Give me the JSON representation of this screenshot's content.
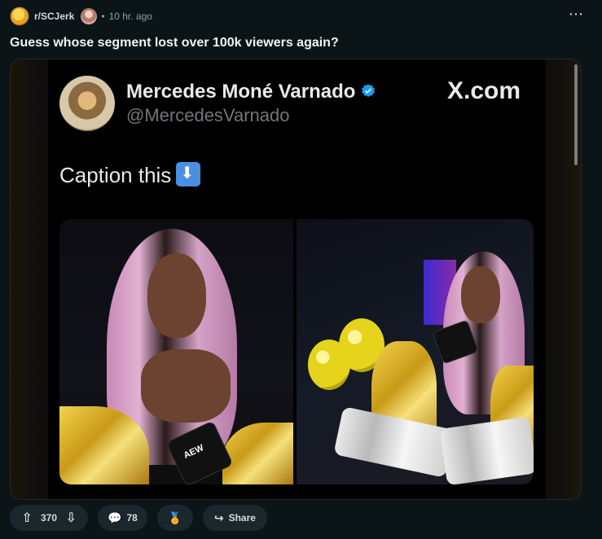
{
  "post": {
    "subreddit": "r/SCJerk",
    "separator": "•",
    "time": "10 hr. ago",
    "more_icon": "⋯",
    "title": "Guess whose segment lost over 100k viewers again?"
  },
  "tweet": {
    "display_name": "Mercedes Moné Varnado",
    "handle": "@MercedesVarnado",
    "site": "X.com",
    "caption": "Caption this",
    "verified_color": "#1d9bf0",
    "mic_logo": "AEW"
  },
  "actions": {
    "upvote_icon": "⇧",
    "score": "370",
    "downvote_icon": "⇩",
    "comment_icon": "💬",
    "comment_count": "78",
    "award_icon": "🏅",
    "share_icon": "↪",
    "share_label": "Share"
  }
}
